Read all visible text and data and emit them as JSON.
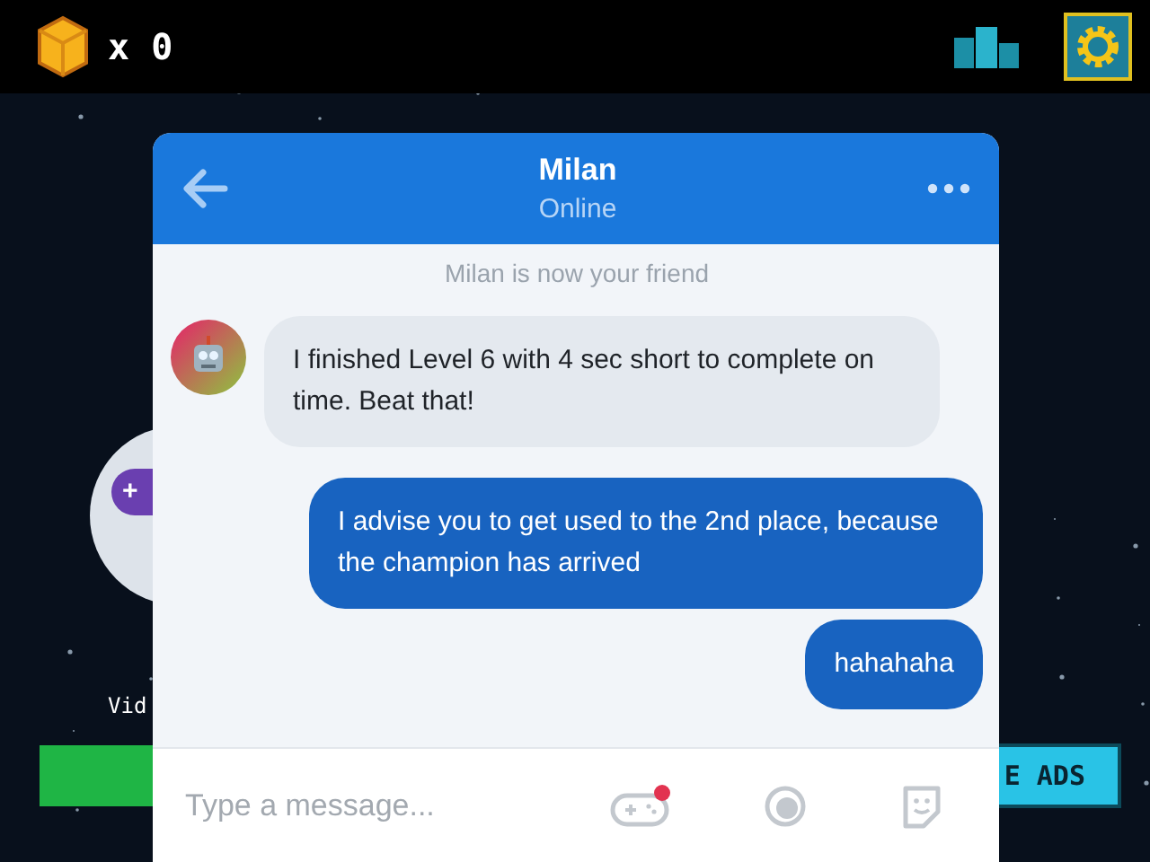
{
  "top_bar": {
    "block_count": "x 0"
  },
  "background": {
    "plus_badge": "+",
    "video_label": "Vid",
    "ads_button": "E ADS"
  },
  "chat": {
    "contact_name": "Milan",
    "status": "Online",
    "notice": "Milan is now your friend",
    "messages": [
      {
        "kind": "incoming",
        "text": "I finished Level 6 with 4 sec short to complete on time. Beat that!"
      },
      {
        "kind": "outgoing",
        "text": "I advise you to get used to the 2nd place, because the champion has arrived"
      },
      {
        "kind": "outgoing",
        "text": "hahahaha"
      }
    ],
    "input": {
      "placeholder": "Type a message..."
    },
    "games_notification": true
  }
}
